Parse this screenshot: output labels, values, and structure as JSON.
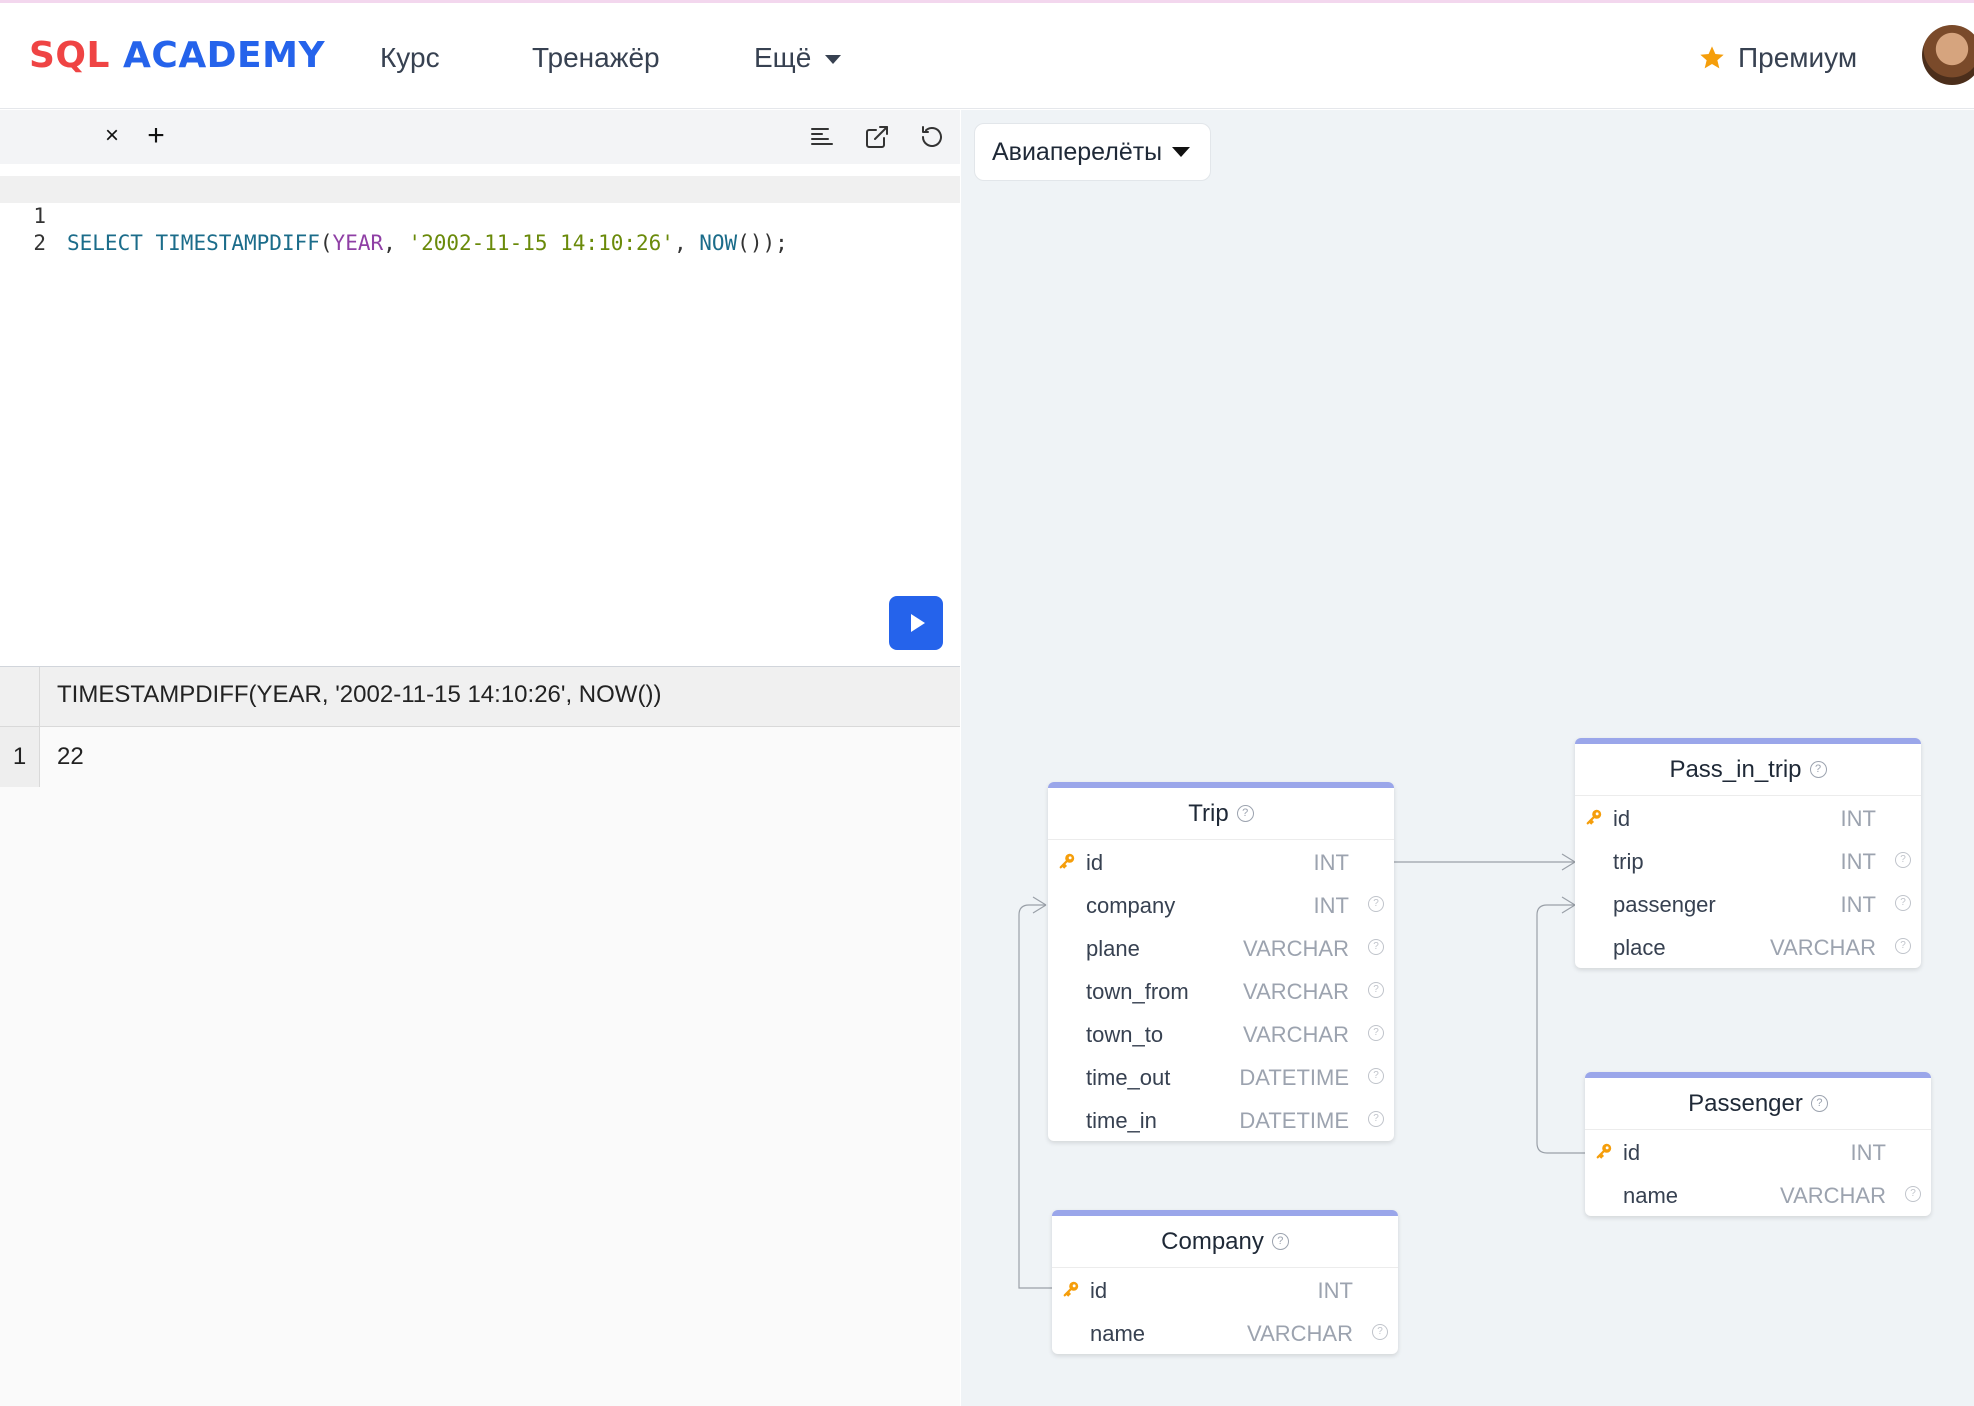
{
  "header": {
    "logo_sql": "SQL",
    "logo_academy": "ACADEMY",
    "nav": [
      "Курс",
      "Тренажёр",
      "Ещё"
    ],
    "premium_label": "Премиум"
  },
  "editor": {
    "line_numbers": [
      "1",
      "2"
    ],
    "code": {
      "kw_select": "SELECT",
      "fn_name": "TIMESTAMPDIFF",
      "open_paren": "(",
      "arg_year": "YEAR",
      "comma1": ", ",
      "str_date": "'2002-11-15 14:10:26'",
      "comma2": ", ",
      "fn_now": "NOW",
      "tail": "());"
    }
  },
  "results": {
    "column": "TIMESTAMPDIFF(YEAR, '2002-11-15 14:10:26', NOW())",
    "row_index": "1",
    "value": "22"
  },
  "schema": {
    "db_name": "Авиаперелёты",
    "tables": {
      "trip": {
        "title": "Trip",
        "columns": [
          {
            "name": "id",
            "type": "INT"
          },
          {
            "name": "company",
            "type": "INT"
          },
          {
            "name": "plane",
            "type": "VARCHAR"
          },
          {
            "name": "town_from",
            "type": "VARCHAR"
          },
          {
            "name": "town_to",
            "type": "VARCHAR"
          },
          {
            "name": "time_out",
            "type": "DATETIME"
          },
          {
            "name": "time_in",
            "type": "DATETIME"
          }
        ]
      },
      "pass_in_trip": {
        "title": "Pass_in_trip",
        "columns": [
          {
            "name": "id",
            "type": "INT"
          },
          {
            "name": "trip",
            "type": "INT"
          },
          {
            "name": "passenger",
            "type": "INT"
          },
          {
            "name": "place",
            "type": "VARCHAR"
          }
        ]
      },
      "passenger": {
        "title": "Passenger",
        "columns": [
          {
            "name": "id",
            "type": "INT"
          },
          {
            "name": "name",
            "type": "VARCHAR"
          }
        ]
      },
      "company": {
        "title": "Company",
        "columns": [
          {
            "name": "id",
            "type": "INT"
          },
          {
            "name": "name",
            "type": "VARCHAR"
          }
        ]
      }
    }
  },
  "colors": {
    "brand_red": "#ef4444",
    "brand_blue": "#2563eb",
    "table_header_accent": "#9aa6ea",
    "diagram_bg": "#eff3f6"
  }
}
